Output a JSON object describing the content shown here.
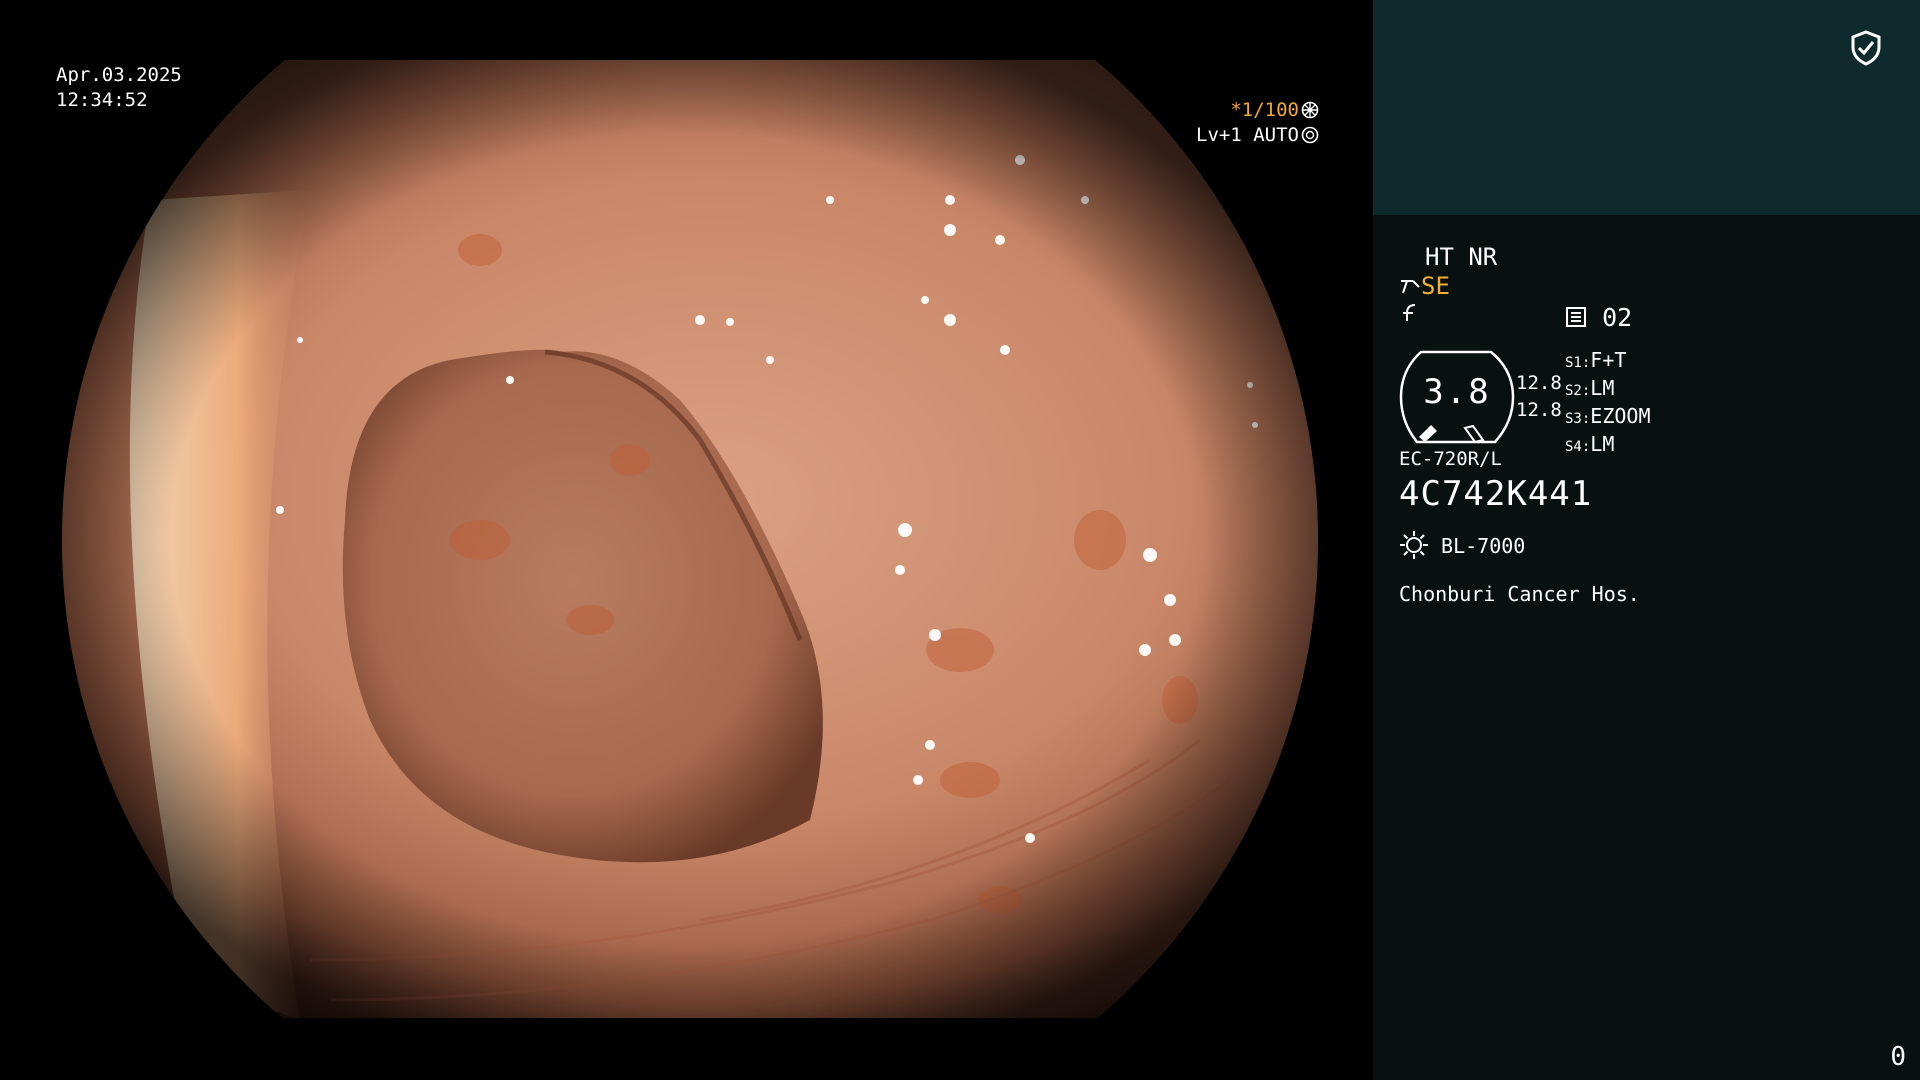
{
  "overlay": {
    "date": "Apr.03.2025",
    "time": "12:34:52",
    "shutter": "*1/100",
    "level": "Lv+1 AUTO",
    "icons": [
      "shutter-icon",
      "iris-icon"
    ],
    "colors": {
      "amber": "#f0a830"
    }
  },
  "panel": {
    "ht_nr": "HT NR",
    "se": "SE",
    "memory": "02",
    "gauge_value": "3.8",
    "value_a": "12.8",
    "value_b": "12.8",
    "scope_settings": [
      {
        "key": "S1",
        "value": "F+T"
      },
      {
        "key": "S2",
        "value": "LM"
      },
      {
        "key": "S3",
        "value": "EZOOM"
      },
      {
        "key": "S4",
        "value": "LM"
      }
    ],
    "scope_model": "EC-720R/L",
    "serial": "4C742K441",
    "light_source": "BL-7000",
    "hospital": "Chonburi Cancer Hos.",
    "counter": "0",
    "icons": [
      "shield-check-icon",
      "scope-icon",
      "freeze-icon",
      "memory-icon",
      "light-icon"
    ],
    "colors": {
      "background": "#081010",
      "header": "#0f2a2c",
      "amber": "#f0b038"
    }
  }
}
